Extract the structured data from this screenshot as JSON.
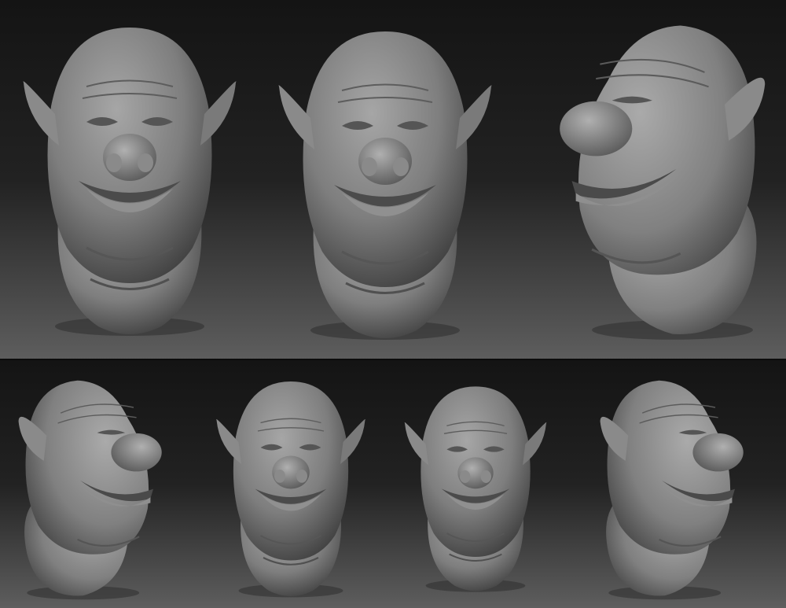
{
  "sheet": {
    "views": [
      {
        "id": "top-three-quarter-left",
        "row": "top"
      },
      {
        "id": "top-front",
        "row": "top"
      },
      {
        "id": "top-three-quarter-right",
        "row": "top"
      },
      {
        "id": "bottom-three-quarter-left",
        "row": "bottom"
      },
      {
        "id": "bottom-front-left",
        "row": "bottom"
      },
      {
        "id": "bottom-front",
        "row": "bottom"
      },
      {
        "id": "bottom-profile-right",
        "row": "bottom"
      }
    ]
  },
  "colors": {
    "background_dark": "#151515",
    "floor_gradient_end": "#5c5c5c",
    "clay_light": "#a2a2a2",
    "clay_mid": "#7b7b7b",
    "clay_dark": "#3e3e3e"
  }
}
